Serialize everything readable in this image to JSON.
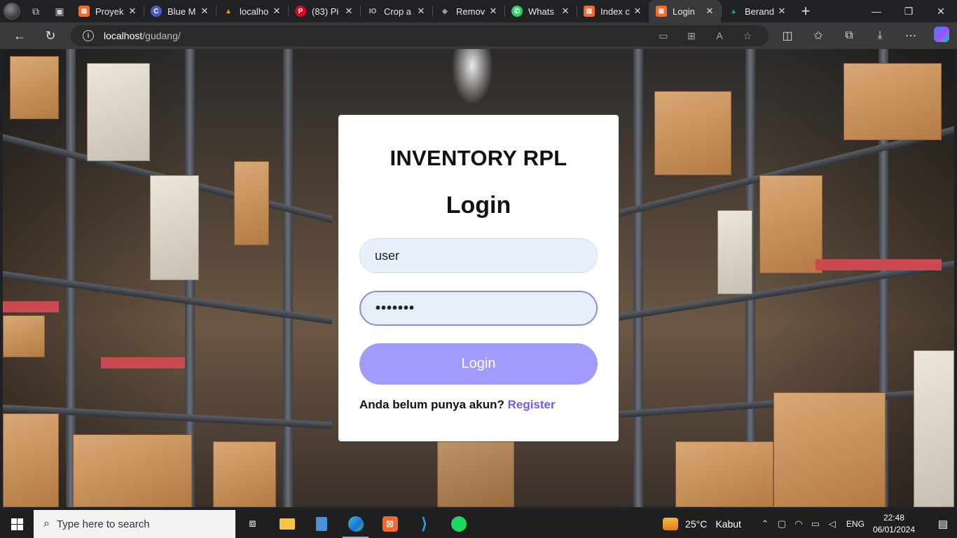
{
  "browser": {
    "tabs": [
      {
        "title": "Proyek",
        "favicon": "xampp-icon",
        "color": "#f06b2c",
        "glyph": "⊠"
      },
      {
        "title": "Blue M",
        "favicon": "c-logo-icon",
        "color": "#4a5bd1",
        "glyph": "C"
      },
      {
        "title": "localho",
        "favicon": "phpmyadmin-icon",
        "color": "#f4a016",
        "glyph": "▲"
      },
      {
        "title": "(83) Pi",
        "favicon": "pinterest-icon",
        "color": "#e60023",
        "glyph": "P"
      },
      {
        "title": "Crop a",
        "favicon": "crop-icon",
        "color": "#555555",
        "glyph": "IO"
      },
      {
        "title": "Remov",
        "favicon": "remove-bg-icon",
        "color": "#666666",
        "glyph": "◆"
      },
      {
        "title": "Whats",
        "favicon": "whatsapp-icon",
        "color": "#25d366",
        "glyph": "✆"
      },
      {
        "title": "Index c",
        "favicon": "xampp-icon",
        "color": "#f06b2c",
        "glyph": "⊠"
      },
      {
        "title": "Login",
        "favicon": "xampp-icon",
        "color": "#f06b2c",
        "glyph": "⊠",
        "active": true
      },
      {
        "title": "Berand",
        "favicon": "google-drive-icon",
        "color": "#1fa463",
        "glyph": "▲"
      }
    ],
    "url_host": "localhost",
    "url_path": "/gudang/"
  },
  "login": {
    "brand": "INVENTORY RPL",
    "heading": "Login",
    "username_value": "user",
    "password_value": "•••••••",
    "submit_label": "Login",
    "register_prompt": "Anda belum punya akun?",
    "register_link": "Register"
  },
  "taskbar": {
    "search_placeholder": "Type here to search",
    "weather_temp": "25°C",
    "weather_desc": "Kabut",
    "language": "ENG",
    "time": "22:48",
    "date": "06/01/2024"
  }
}
